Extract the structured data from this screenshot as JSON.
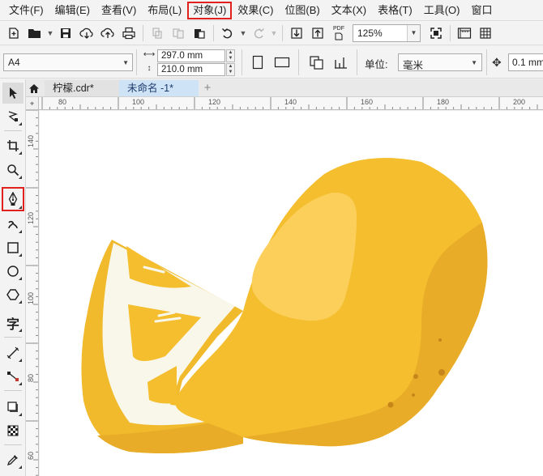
{
  "menu": {
    "items": [
      "文件(F)",
      "编辑(E)",
      "查看(V)",
      "布局(L)",
      "对象(J)",
      "效果(C)",
      "位图(B)",
      "文本(X)",
      "表格(T)",
      "工具(O)",
      "窗口"
    ],
    "highlighted_index": 4
  },
  "toolbar": {
    "zoom": "125%",
    "pdf_label": "PDF"
  },
  "propbar": {
    "page_size": "A4",
    "width": "297.0 mm",
    "height": "210.0 mm",
    "unit_label": "单位:",
    "unit_value": "毫米",
    "nudge": "0.1 mm"
  },
  "tabs": {
    "items": [
      "柠檬.cdr*",
      "未命名 -1*"
    ],
    "active_index": 1
  },
  "rulers": {
    "top_labels": [
      "80",
      "100",
      "120",
      "140",
      "160",
      "180",
      "200"
    ],
    "left_labels": [
      "140",
      "120",
      "100",
      "80",
      "60"
    ]
  },
  "toolbox": {
    "tools": [
      "pick-tool",
      "shape-tool",
      "crop-tool",
      "zoom-tool",
      "pen-tool",
      "artistic-media-tool",
      "rectangle-tool",
      "ellipse-tool",
      "polygon-tool",
      "text-tool",
      "parallel-dimension-tool",
      "connector-tool",
      "drop-shadow-tool",
      "transparency-tool",
      "eyedropper-tool"
    ],
    "highlighted_tool": "pen-tool"
  },
  "colors": {
    "lemon_body": "#f4be2e",
    "lemon_shadow": "#e8ac28",
    "lemon_highlight": "#fbcf5a",
    "pith": "#f8f7ea",
    "pores": "#c8861a",
    "highlight_outline": "#e0211d",
    "active_tab": "#cfe3f7"
  }
}
